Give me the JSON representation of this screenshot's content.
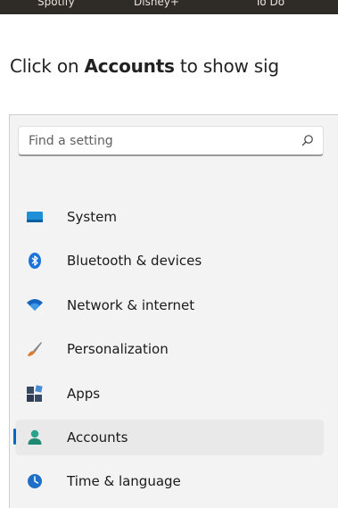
{
  "taskbar": {
    "items": [
      "Spotify",
      "Disney+",
      "To Do"
    ]
  },
  "instruction": {
    "before": "Click on ",
    "bold": "Accounts",
    "after": " to show sig"
  },
  "settings": {
    "search": {
      "placeholder": "Find a setting"
    },
    "nav": [
      {
        "label": "System",
        "icon": "system-icon"
      },
      {
        "label": "Bluetooth & devices",
        "icon": "bluetooth-icon"
      },
      {
        "label": "Network & internet",
        "icon": "wifi-icon"
      },
      {
        "label": "Personalization",
        "icon": "brush-icon"
      },
      {
        "label": "Apps",
        "icon": "apps-icon"
      },
      {
        "label": "Accounts",
        "icon": "person-icon",
        "selected": true
      },
      {
        "label": "Time & language",
        "icon": "clock-globe-icon"
      }
    ]
  },
  "colors": {
    "accent": "#0067c0",
    "panel_bg": "#f3f3f3",
    "selected_bg": "#e9e9e9"
  }
}
